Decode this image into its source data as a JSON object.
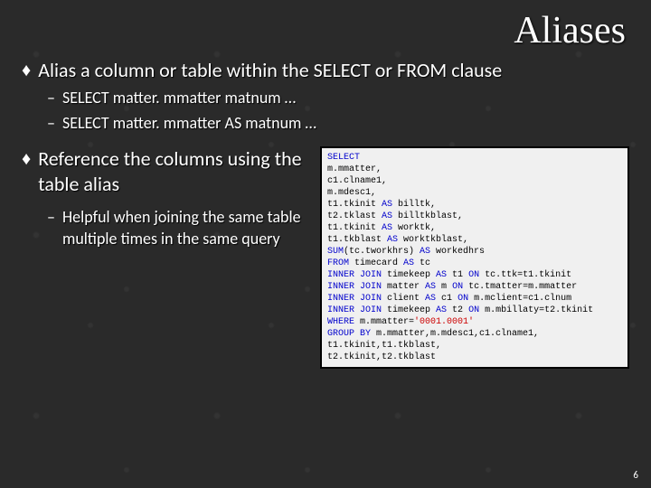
{
  "title": "Aliases",
  "bullets": [
    {
      "text": "Alias a column or table within the SELECT or FROM clause",
      "subs": [
        "SELECT matter. mmatter matnum …",
        "SELECT matter. mmatter AS matnum …"
      ]
    },
    {
      "text": "Reference the columns using the table alias",
      "subs": [
        "Helpful when joining the same table multiple times in the same query"
      ]
    }
  ],
  "code": {
    "kw_select": "SELECT",
    "l1": "m.mmatter,",
    "l2": "c1.clname1,",
    "l3": "m.mdesc1,",
    "l4a": "t1.tkinit ",
    "kw_as": "AS",
    "l4b": " billtk,",
    "l5a": "t2.tklast ",
    "l5b": " billtkblast,",
    "l6a": "t1.tkinit ",
    "l6b": " worktk,",
    "l7a": "t1.tkblast ",
    "l7b": " worktkblast,",
    "kw_sum": "SUM",
    "l8a": "(tc.tworkhrs) ",
    "l8b": " workedhrs",
    "kw_from": "FROM",
    "l9a": " timecard ",
    "l9b": " tc",
    "kw_inner_join": "INNER JOIN",
    "l10a": " timekeep ",
    "l10b": " t1 ",
    "kw_on": "ON",
    "l10c": " tc.ttk=t1.tkinit",
    "l11a": " matter ",
    "l11b": " m ",
    "l11c": " tc.tmatter=m.mmatter",
    "l12a": " client ",
    "l12b": " c1 ",
    "l12c": " m.mclient=c1.clnum",
    "l13a": " timekeep ",
    "l13b": " t2 ",
    "l13c": " m.mbillaty=t2.tkinit",
    "kw_where": "WHERE",
    "l14a": " m.mmatter=",
    "lit_val": "'0001.0001'",
    "kw_group_by": "GROUP BY",
    "l15": " m.mmatter,m.mdesc1,c1.clname1,",
    "l16": "t1.tkinit,t1.tkblast,",
    "l17": "t2.tkinit,t2.tkblast"
  },
  "page_number": "6"
}
